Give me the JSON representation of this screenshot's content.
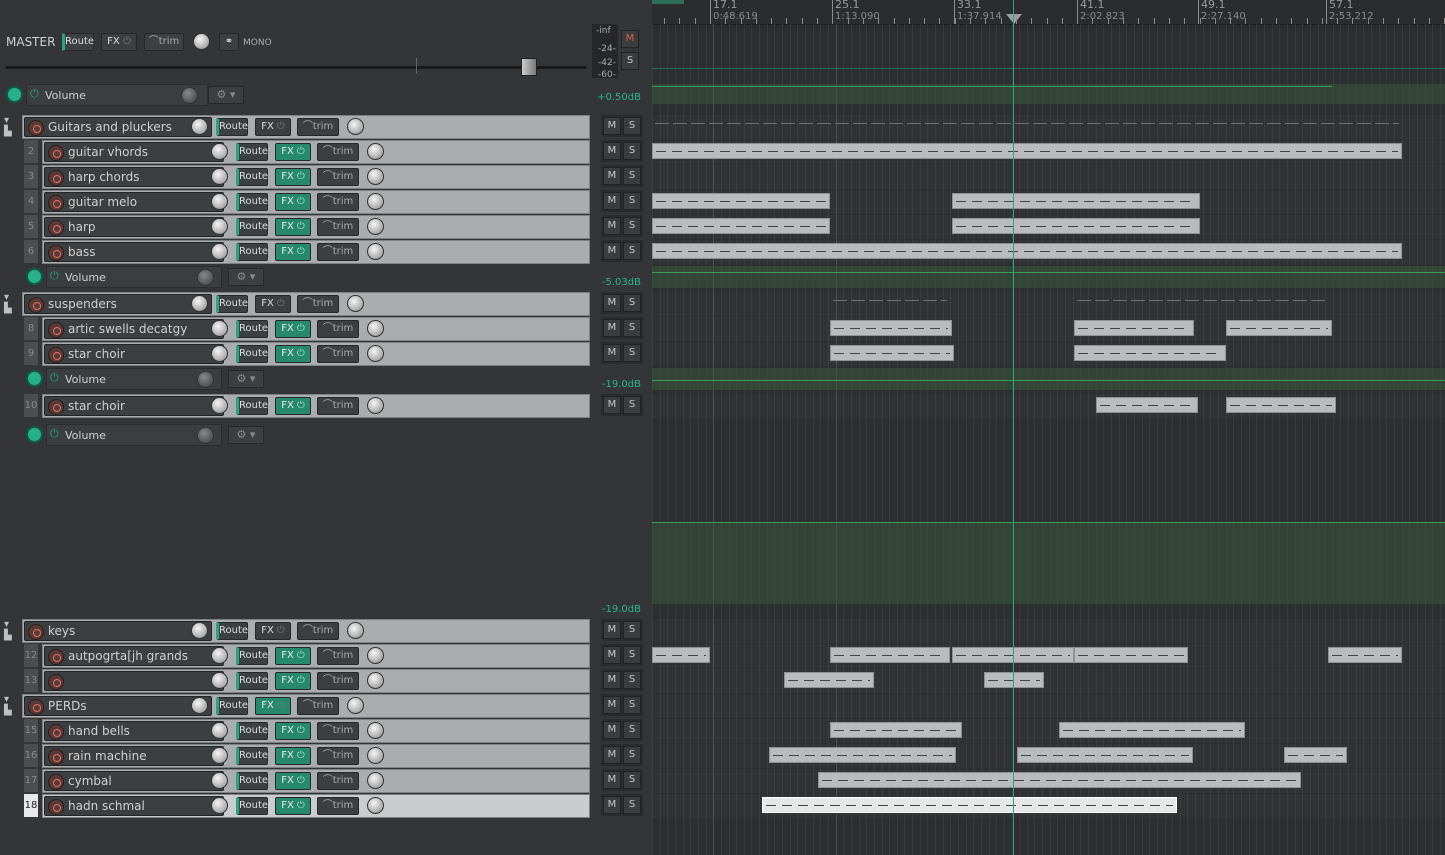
{
  "master": {
    "label": "MASTER",
    "route": "Route",
    "fx": "FX",
    "trim": "trim",
    "mono": "MONO",
    "meter_labels": [
      "-inf",
      "-24-",
      "-42-",
      "-60-"
    ],
    "m": "M",
    "s": "S",
    "env_label": "Volume",
    "env_db": "+0.50dB"
  },
  "common": {
    "route": "Route",
    "fx": "FX",
    "trim": "trim",
    "m": "M",
    "s": "S",
    "volume": "Volume"
  },
  "tracks": [
    {
      "num": "",
      "name": "Guitars and pluckers",
      "folder": true
    },
    {
      "num": "2",
      "name": "guitar vhords"
    },
    {
      "num": "3",
      "name": "harp chords"
    },
    {
      "num": "4",
      "name": "guitar melo"
    },
    {
      "num": "5",
      "name": "harp"
    },
    {
      "num": "6",
      "name": "bass"
    },
    {
      "num": "",
      "name": "suspenders",
      "folder": true
    },
    {
      "num": "8",
      "name": "artic swells decatgy"
    },
    {
      "num": "9",
      "name": "star choir"
    },
    {
      "num": "10",
      "name": "star choir"
    },
    {
      "num": "",
      "name": "keys",
      "folder": true
    },
    {
      "num": "12",
      "name": "autpogrta[jh grands"
    },
    {
      "num": "13",
      "name": ""
    },
    {
      "num": "",
      "name": "PERDs",
      "folder": true
    },
    {
      "num": "15",
      "name": "hand bells"
    },
    {
      "num": "16",
      "name": "rain machine"
    },
    {
      "num": "17",
      "name": "cymbal"
    },
    {
      "num": "18",
      "name": "hadn schmal",
      "selected": true
    }
  ],
  "envelopes": [
    {
      "label": "Volume",
      "db": "-5.03dB"
    },
    {
      "label": "Volume",
      "db": "-19.0dB"
    },
    {
      "label": "Volume",
      "db": "-19.0dB"
    }
  ],
  "ruler": [
    {
      "bar": "17.1",
      "time": "0:48.619"
    },
    {
      "bar": "25.1",
      "time": "1:13.090"
    },
    {
      "bar": "33.1",
      "time": "1:37.914"
    },
    {
      "bar": "41.1",
      "time": "2:02.823"
    },
    {
      "bar": "49.1",
      "time": "2:27.140"
    },
    {
      "bar": "57.1",
      "time": "2:53.212"
    }
  ],
  "colors": {
    "accent": "#2aa384",
    "item": "#b8bcbc",
    "selected_item": "#e6e8e8",
    "envelope": "#3f9a57"
  }
}
